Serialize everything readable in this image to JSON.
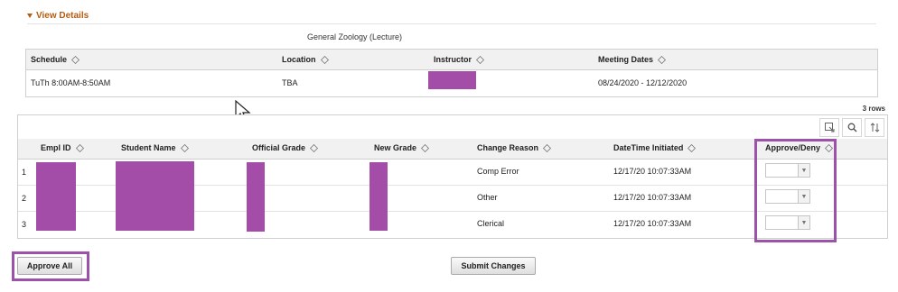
{
  "section": {
    "toggle_label": "View Details"
  },
  "course": {
    "title": "General Zoology (Lecture)"
  },
  "schedule": {
    "headers": [
      "Schedule",
      "Location",
      "Instructor",
      "Meeting Dates"
    ],
    "row": {
      "schedule": "TuTh 8:00AM-8:50AM",
      "location": "TBA",
      "meeting_dates": "08/24/2020 - 12/12/2020"
    }
  },
  "grid": {
    "rows_label": "3 rows",
    "headers": [
      "Empl ID",
      "Student Name",
      "Official Grade",
      "New Grade",
      "Change Reason",
      "DateTime Initiated",
      "Approve/Deny"
    ],
    "rows": [
      {
        "num": "1",
        "reason": "Comp Error",
        "initiated": "12/17/20 10:07:33AM"
      },
      {
        "num": "2",
        "reason": "Other",
        "initiated": "12/17/20 10:07:33AM"
      },
      {
        "num": "3",
        "reason": "Clerical",
        "initiated": "12/17/20 10:07:33AM"
      }
    ]
  },
  "actions": {
    "approve_all": "Approve All",
    "submit": "Submit Changes"
  },
  "colors": {
    "accent": "#b35c12",
    "redaction": "#a34ca8",
    "highlight": "#9c52a9"
  },
  "icons": [
    "caret-down-icon",
    "sort-icon",
    "export-icon",
    "search-icon",
    "sort-rows-icon",
    "chevron-down-icon",
    "mouse-cursor-icon"
  ]
}
